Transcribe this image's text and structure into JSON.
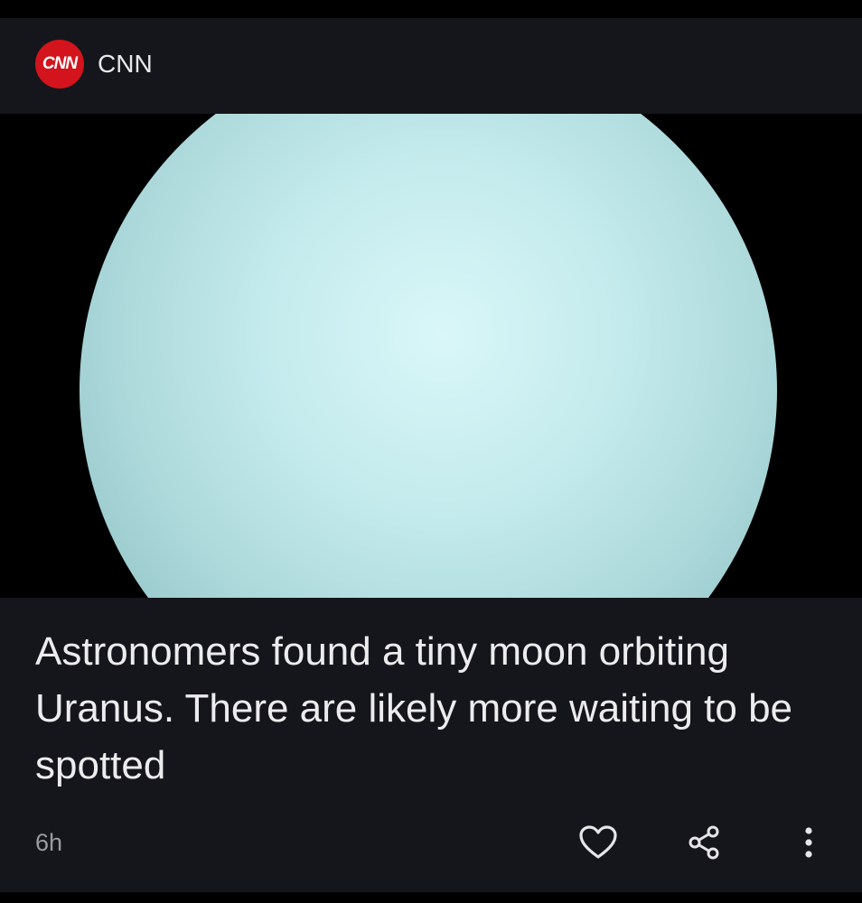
{
  "source": {
    "logo_text": "CNN",
    "logo_color": "#d3141c",
    "name": "CNN"
  },
  "hero_image": {
    "description_icon": "uranus-image"
  },
  "article": {
    "headline": "Astronomers found a tiny moon orbiting Uranus. There are likely more waiting to be spotted",
    "age": "6h"
  },
  "actions": {
    "like_icon": "heart-icon",
    "share_icon": "share-icon",
    "more_icon": "more-vertical-icon"
  },
  "colors": {
    "card_background": "#15161b",
    "text_primary": "#ececee",
    "text_secondary": "#9a9ba1"
  }
}
